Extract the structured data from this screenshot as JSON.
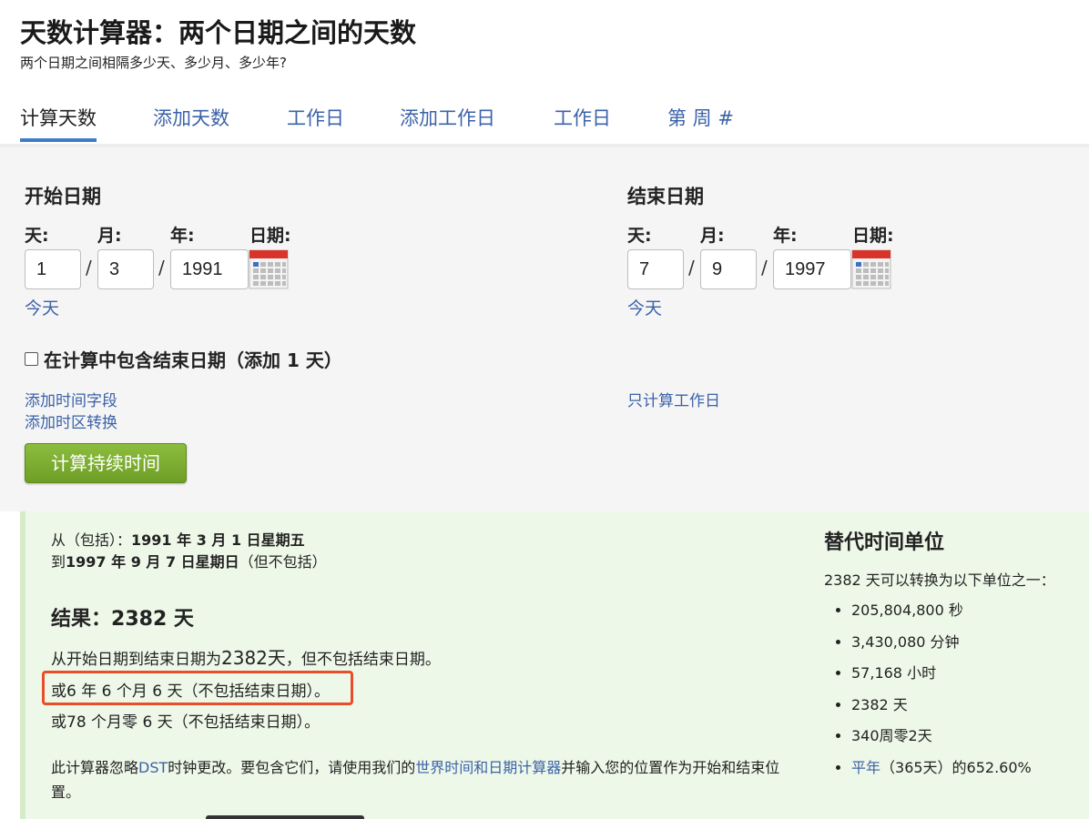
{
  "header": {
    "title": "天数计算器：两个日期之间的天数",
    "subtitle": "两个日期之间相隔多少天、多少月、多少年?"
  },
  "tabs": [
    {
      "label": "计算天数",
      "active": true
    },
    {
      "label": "添加天数"
    },
    {
      "label": "工作日"
    },
    {
      "label": "添加工作日"
    },
    {
      "label": "工作日"
    },
    {
      "label": "第 周 #"
    }
  ],
  "start": {
    "title": "开始日期",
    "day_label": "天:",
    "month_label": "月:",
    "year_label": "年:",
    "date_label": "日期:",
    "day": "1",
    "month": "3",
    "year": "1991",
    "today": "今天"
  },
  "end": {
    "title": "结束日期",
    "day_label": "天:",
    "month_label": "月:",
    "year_label": "年:",
    "date_label": "日期:",
    "day": "7",
    "month": "9",
    "year": "1997",
    "today": "今天"
  },
  "slash": "/",
  "include_end": {
    "label": "在计算中包含结束日期（添加 1 天）",
    "checked": false
  },
  "links": {
    "add_time": "添加时间字段",
    "add_timezone": "添加时区转换",
    "workdays_only": "只计算工作日"
  },
  "button": {
    "label": "计算持续时间"
  },
  "result": {
    "from_prefix": "从（包括）：",
    "from_date": "1991 年 3 月 1 日星期五",
    "to_prefix": "到",
    "to_date": "1997 年 9 月 7 日星期日",
    "to_suffix": "（但不包括）",
    "title_prefix": "结果：",
    "title_value": "2382 天",
    "line1_prefix": "从开始日期到结束日期为",
    "line1_value": "2382天",
    "line1_suffix": "，但不包括结束日期。",
    "line2": "或6 年 6 个月 6 天（不包括结束日期）。",
    "line3": "或78 个月零 6 天（不包括结束日期）。",
    "note_part1": "此计算器忽略",
    "note_link1": "DST",
    "note_part2": "时钟更改。要包含它们，请使用我们的",
    "note_link2": "世界时间和日期计算器",
    "note_part3": "并输入您的位置作为开始和结束位置。"
  },
  "alt": {
    "title": "替代时间单位",
    "intro": "2382 天可以转换为以下单位之一：",
    "items": [
      "205,804,800 秒",
      "3,430,080 分钟",
      "57,168 小时",
      "2382 天",
      "340周零2天"
    ],
    "last_link": "平年",
    "last_suffix": "（365天）的652.60%"
  },
  "colors": {
    "link": "#3b62a8",
    "tab_underline": "#3d7cc9",
    "button": "#7aab2f",
    "result_bg": "#eef8e9",
    "highlight": "#e94e2a"
  },
  "icons": {
    "calendar": "calendar-icon"
  }
}
